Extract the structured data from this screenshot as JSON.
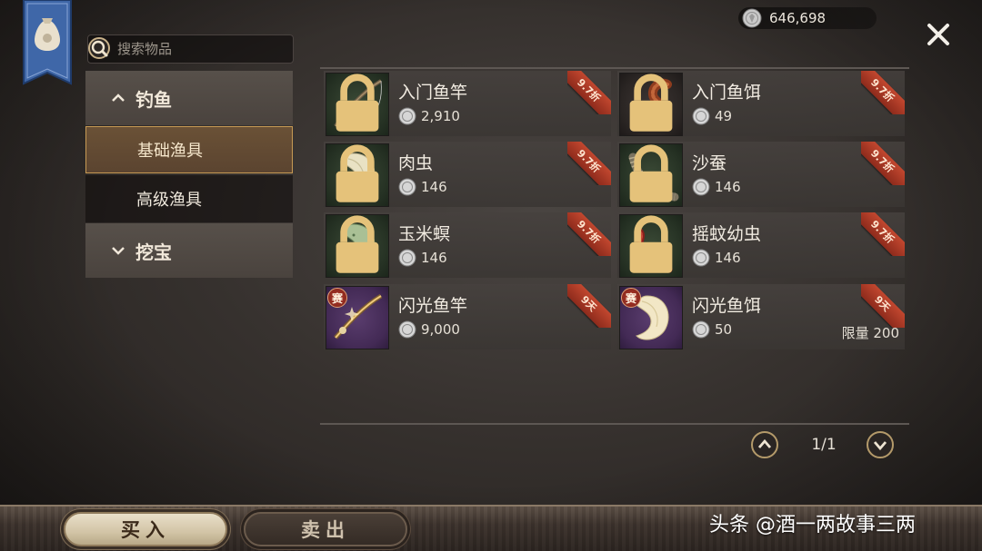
{
  "currency": {
    "amount": "646,698"
  },
  "search": {
    "placeholder": "搜索物品"
  },
  "categories": [
    {
      "label": "钓鱼",
      "expanded": true,
      "subcategories": [
        {
          "label": "基础渔具",
          "selected": true
        },
        {
          "label": "高级渔具",
          "selected": false
        }
      ]
    },
    {
      "label": "挖宝",
      "expanded": false
    }
  ],
  "items": [
    {
      "name": "入门鱼竿",
      "price": "2,910",
      "ribbon": "9.7折",
      "badge": "lock",
      "thumb": "fishing-rod",
      "thumb_bg": "green"
    },
    {
      "name": "入门鱼饵",
      "price": "49",
      "ribbon": "9.7折",
      "badge": "lock",
      "thumb": "earthworm",
      "thumb_bg": "dark"
    },
    {
      "name": "肉虫",
      "price": "146",
      "ribbon": "9.7折",
      "badge": "lock",
      "thumb": "white-grub",
      "thumb_bg": "green"
    },
    {
      "name": "沙蚕",
      "price": "146",
      "ribbon": "9.7折",
      "badge": "lock",
      "thumb": "sandworm",
      "thumb_bg": "green"
    },
    {
      "name": "玉米螟",
      "price": "146",
      "ribbon": "9.7折",
      "badge": "lock",
      "thumb": "green-larva",
      "thumb_bg": "green"
    },
    {
      "name": "摇蚊幼虫",
      "price": "146",
      "ribbon": "9.7折",
      "badge": "lock",
      "thumb": "red-larva",
      "thumb_bg": "green"
    },
    {
      "name": "闪光鱼竿",
      "price": "9,000",
      "ribbon": "9天",
      "badge": "赛",
      "thumb": "shiny-rod",
      "thumb_bg": "purple"
    },
    {
      "name": "闪光鱼饵",
      "price": "50",
      "ribbon": "9天",
      "badge": "赛",
      "thumb": "shiny-grub",
      "thumb_bg": "purple",
      "limit": "限量 200"
    }
  ],
  "pagination": {
    "label": "1/1"
  },
  "bottom": {
    "buy_label": "买入",
    "sell_label": "卖出"
  },
  "watermark": "头条 @酒一两故事三两",
  "colors": {
    "ribbon": "#b23a26",
    "selected_border": "#c79a54",
    "banner": "#3f67a8"
  }
}
